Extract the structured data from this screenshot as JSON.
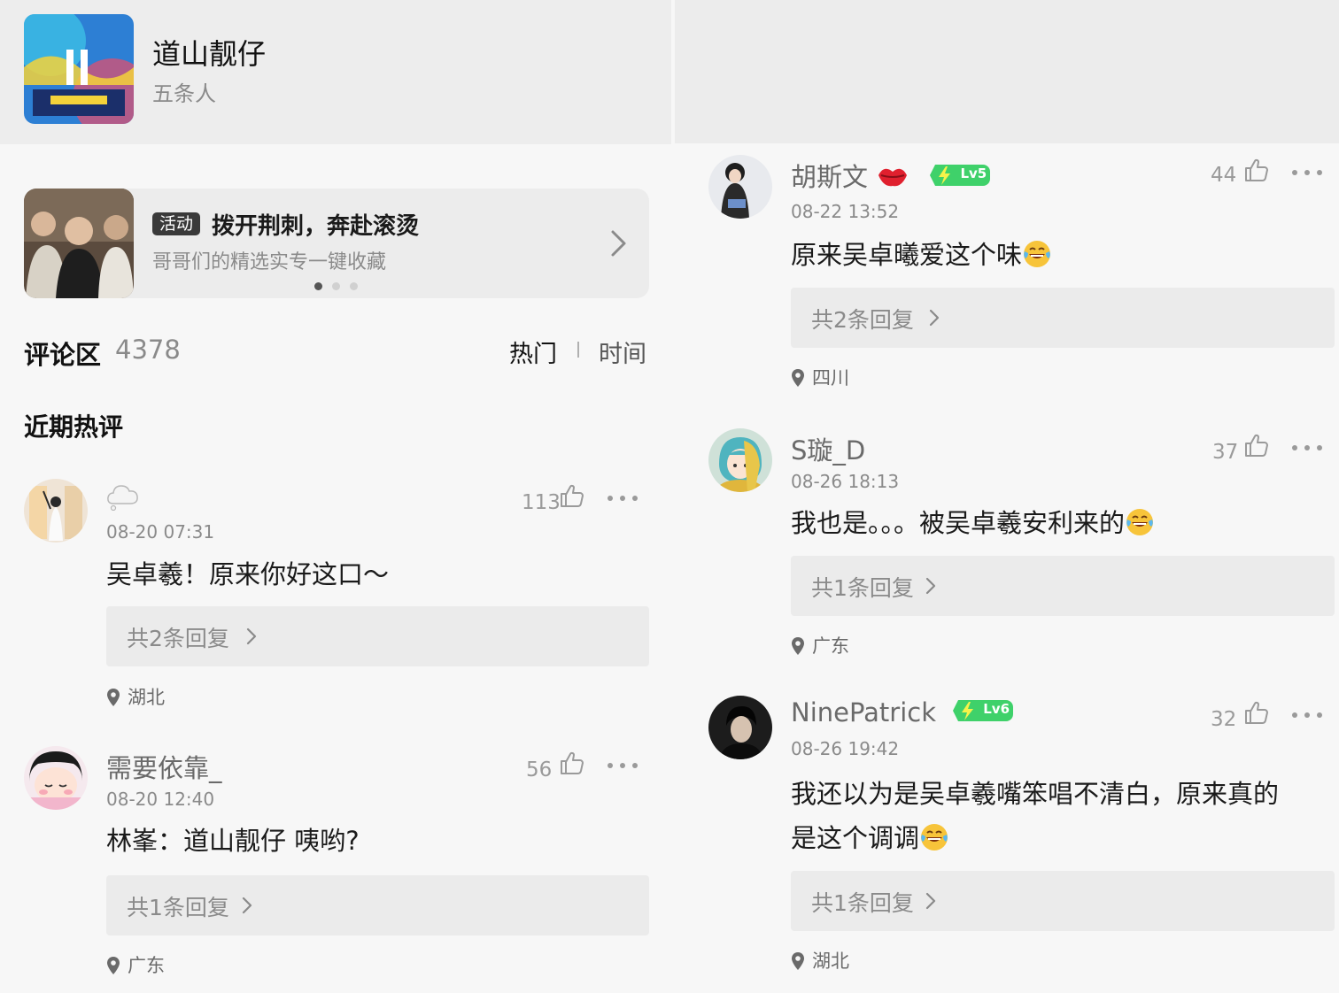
{
  "song": {
    "title": "道山靓仔",
    "artist": "五条人"
  },
  "banner": {
    "badge": "活动",
    "title": "拨开荆刺，奔赴滚烫",
    "subtitle": "哥哥们的精选实专一键收藏"
  },
  "comments_section": {
    "heading": "评论区",
    "count": "4378",
    "sort_hot": "热门",
    "sort_time": "时间",
    "recent_hot_title": "近期热评"
  },
  "left_comments": [
    {
      "user": "",
      "time": "08-20 07:31",
      "likes": "113",
      "text": "吴卓羲！原来你好这口～",
      "replies": "共2条回复",
      "location": "湖北"
    },
    {
      "user": "需要依靠_",
      "time": "08-20 12:40",
      "likes": "56",
      "text": "林峯：道山靓仔 咦哟?",
      "replies": "共1条回复",
      "location": "广东"
    }
  ],
  "right_comments": [
    {
      "user": "胡斯文",
      "level": "Lv5",
      "time": "08-22 13:52",
      "likes": "44",
      "text": "原来吴卓曦爱这个味",
      "replies": "共2条回复",
      "location": "四川"
    },
    {
      "user": "S璇_D",
      "time": "08-26 18:13",
      "likes": "37",
      "text": "我也是。。。被吴卓羲安利来的",
      "replies": "共1条回复",
      "location": "广东"
    },
    {
      "user": "NinePatrick",
      "level": "Lv6",
      "time": "08-26 19:42",
      "likes": "32",
      "text_line1": "我还以为是吴卓羲嘴笨唱不清白，原来真的",
      "text_line2": "是这个调调",
      "replies": "共1条回复",
      "location": "湖北"
    }
  ],
  "colors": {
    "level_badge": "#3fd16a",
    "background": "#f7f7f7",
    "reply_box": "#ebebeb"
  },
  "icons": [
    "thumb-up-icon",
    "more-icon",
    "location-pin-icon",
    "chevron-right-icon",
    "laugh-cry-emoji",
    "kiss-lips-icon",
    "lightning-icon",
    "cloud-icon"
  ]
}
